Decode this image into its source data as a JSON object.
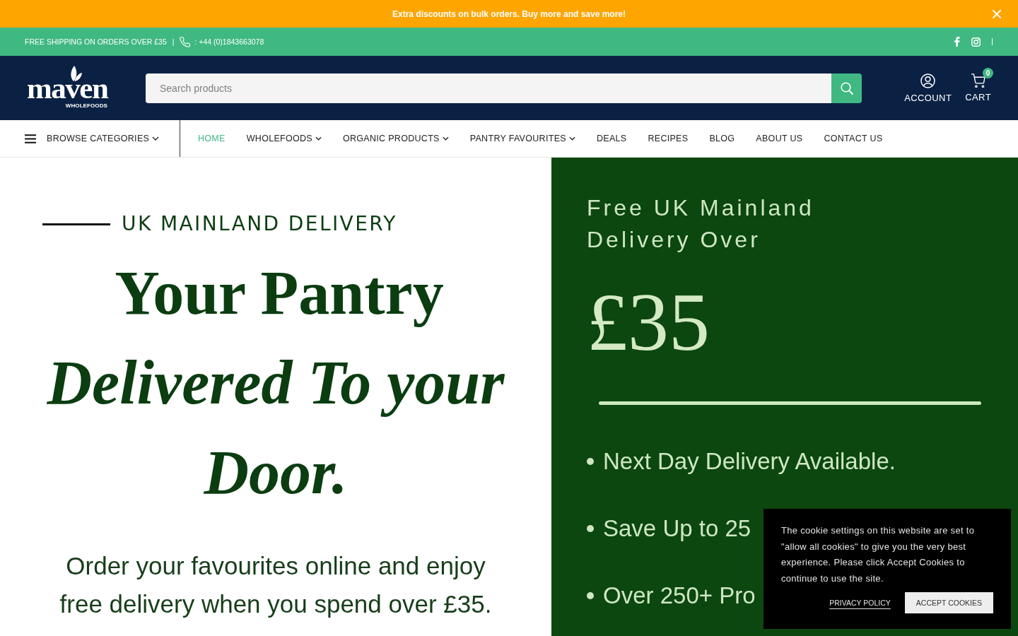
{
  "announcement_bar": {
    "text": "Extra discounts on bulk orders. Buy more and save more!"
  },
  "top_bar": {
    "shipping_text": "FREE SHIPPING ON ORDERS OVER £35",
    "separator": "|",
    "phone": ": +44 (0)1843663078"
  },
  "header": {
    "logo": {
      "wordmark": "maven",
      "tagline": "WHOLEFOODS"
    },
    "search": {
      "placeholder": "Search products"
    },
    "account": {
      "label": "ACCOUNT"
    },
    "cart": {
      "label": "CART",
      "count": "0"
    }
  },
  "nav": {
    "browse_label": "BROWSE CATEGORIES",
    "items": [
      {
        "label": "HOME",
        "selected": true,
        "dropdown": false
      },
      {
        "label": "WHOLEFOODS",
        "selected": false,
        "dropdown": true
      },
      {
        "label": "ORGANIC PRODUCTS",
        "selected": false,
        "dropdown": true
      },
      {
        "label": "PANTRY FAVOURITES",
        "selected": false,
        "dropdown": true
      },
      {
        "label": "DEALS",
        "selected": false,
        "dropdown": false
      },
      {
        "label": "RECIPES",
        "selected": false,
        "dropdown": false
      },
      {
        "label": "BLOG",
        "selected": false,
        "dropdown": false
      },
      {
        "label": "ABOUT US",
        "selected": false,
        "dropdown": false
      },
      {
        "label": "CONTACT US",
        "selected": false,
        "dropdown": false
      }
    ]
  },
  "hero": {
    "left": {
      "eyebrow": "UK MAINLAND DELIVERY",
      "heading_lines": [
        {
          "text": "Your Pantry",
          "kind": "roman"
        },
        {
          "text": "Delivered To your",
          "kind": "italic"
        },
        {
          "text": "Door.",
          "kind": "italic"
        }
      ],
      "body": "Order your favourites online and enjoy free delivery when you spend over £35."
    },
    "right": {
      "title": "Free UK Mainland Delivery Over",
      "amount": "£35",
      "bullets": [
        "Next Day Delivery Available.",
        "Save Up to 25",
        "Over 250+ Pro"
      ]
    }
  },
  "cookie_notice": {
    "text": "The cookie settings on this website are set to \"allow all cookies\" to give you the very best experience. Please click Accept Cookies to continue to use the site.",
    "privacy_link": "PRIVACY POLICY",
    "accept_button": "ACCEPT COOKIES"
  }
}
